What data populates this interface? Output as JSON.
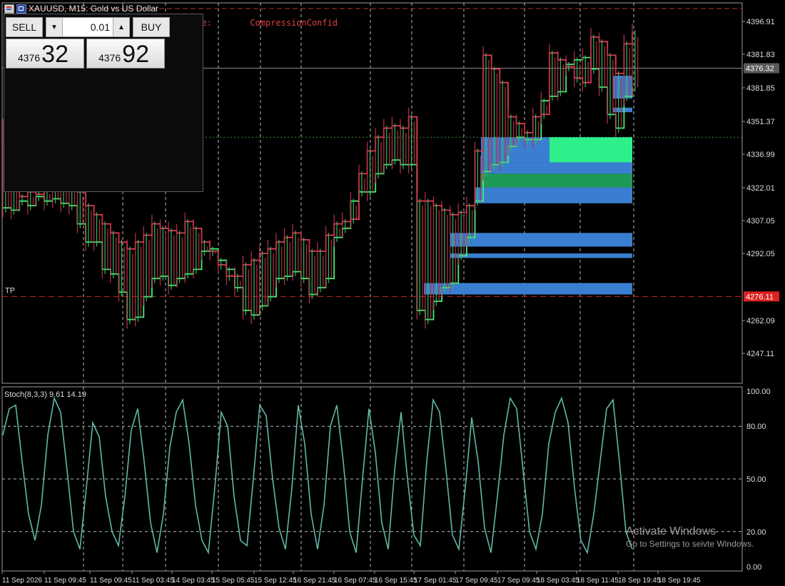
{
  "window": {
    "title": "XAUUSD, M15:  Gold vs US Dollar"
  },
  "indicator_labels": [
    "ceRegime:",
    "CompressionConfid"
  ],
  "trade_panel": {
    "sell_label": "SELL",
    "buy_label": "BUY",
    "lot_value": "0.01",
    "sell_price_small": "4376",
    "sell_price_big": "32",
    "buy_price_small": "4376",
    "buy_price_big": "92"
  },
  "current_price_label": "4376.32",
  "tp_price_label": "4276.11",
  "tp_text": "TP",
  "oscillator_label": "Stoch(8,3,3) 9.61 14.19",
  "watermark": {
    "line1": "Activate Windows",
    "line2": "Go to Settings to seivte Windows."
  },
  "colors": {
    "fast_line": "#44ee77",
    "slow_line": "#e03a55",
    "zone_blue": "#3a7ed1",
    "zone_green": "#2ef08a",
    "zone_dark_green": "#1e9a58",
    "stoch_line": "#5fb8a8",
    "tp_line": "#cc2222",
    "grid": "#bbbbbb"
  },
  "chart_data": [
    {
      "type": "line",
      "name": "price",
      "symbol": "XAUUSD",
      "timeframe": "M15",
      "y_tick_labels": [
        "4396.91",
        "4381.83",
        "4381.85",
        "4351.37",
        "4336.99",
        "4322.01",
        "4307.05",
        "4292.05",
        "4262.09",
        "4247.11"
      ],
      "x_tick_labels": [
        "11 Sep 2026",
        "11 Sep 09:45",
        "11 Sep 09:45",
        "11 Sep 03:45",
        "14 Sep 03:45",
        "15 Sep 05:45",
        "15 Sep 12:45",
        "16 Sep 21:45",
        "16 Sep 07:45",
        "16 Sep 15:45",
        "17 Sep 01:45",
        "17 Sep 09:45",
        "17 Sep 09:45",
        "18 Sep 03:45",
        "18 Sep 11:45",
        "18 Sep 19:45",
        "18 Sep 19:45"
      ],
      "ylim": [
        4238,
        4405
      ],
      "current_price": 4376.32,
      "take_profit": 4276.11,
      "dotted_level": 4346,
      "series": [
        {
          "name": "fast",
          "values": [
            4315,
            4314,
            4318,
            4316,
            4320,
            4318,
            4319,
            4317,
            4316,
            4308,
            4300,
            4300,
            4288,
            4286,
            4278,
            4266,
            4267,
            4276,
            4284,
            4285,
            4281,
            4284,
            4286,
            4288,
            4296,
            4297,
            4292,
            4288,
            4280,
            4270,
            4268,
            4272,
            4276,
            4284,
            4285,
            4287,
            4284,
            4277,
            4280,
            4284,
            4302,
            4306,
            4318,
            4322,
            4322,
            4330,
            4334,
            4336,
            4334,
            4334,
            4270,
            4266,
            4274,
            4280,
            4282,
            4294,
            4302,
            4318,
            4331,
            4334,
            4335,
            4342,
            4346,
            4345,
            4345,
            4362,
            4364,
            4366,
            4378,
            4380,
            4381,
            4376,
            4368,
            4356,
            4350,
            4364,
            4368
          ]
        },
        {
          "name": "slow",
          "values": [
            4350,
            4337,
            4320,
            4322,
            4321,
            4323,
            4326,
            4325,
            4324,
            4322,
            4316,
            4312,
            4308,
            4304,
            4300,
            4297,
            4300,
            4303,
            4308,
            4306,
            4305,
            4304,
            4309,
            4306,
            4300,
            4296,
            4290,
            4285,
            4285,
            4290,
            4292,
            4295,
            4297,
            4300,
            4302,
            4304,
            4301,
            4296,
            4296,
            4303,
            4308,
            4309,
            4310,
            4330,
            4340,
            4346,
            4350,
            4351,
            4350,
            4355,
            4318,
            4318,
            4316,
            4314,
            4312,
            4313,
            4316,
            4340,
            4382,
            4376,
            4370,
            4355,
            4352,
            4348,
            4355,
            4356,
            4383,
            4380,
            4377,
            4372,
            4370,
            4390,
            4388,
            4382,
            4374,
            4387,
            4392
          ]
        }
      ],
      "zones": [
        {
          "kind": "blue",
          "top": 4346,
          "bottom": 4335
        },
        {
          "kind": "green",
          "top": 4346,
          "bottom": 4335
        },
        {
          "kind": "blue",
          "top": 4335,
          "bottom": 4330
        },
        {
          "kind": "dark_green",
          "top": 4330,
          "bottom": 4324
        },
        {
          "kind": "blue",
          "top": 4324,
          "bottom": 4317
        },
        {
          "kind": "blue",
          "top": 4304,
          "bottom": 4298
        },
        {
          "kind": "blue",
          "top": 4295,
          "bottom": 4293
        },
        {
          "kind": "blue",
          "top": 4282,
          "bottom": 4277
        },
        {
          "kind": "blue",
          "top": 4373,
          "bottom": 4363
        },
        {
          "kind": "blue",
          "top": 4359,
          "bottom": 4357
        }
      ]
    },
    {
      "type": "line",
      "name": "Stoch(8,3,3)",
      "ylim": [
        0,
        100
      ],
      "y_tick_labels": [
        "100.00",
        "80.00",
        "50.00",
        "20.00",
        "0.00"
      ],
      "levels": [
        80,
        50,
        20
      ],
      "values": [
        75,
        90,
        92,
        60,
        30,
        15,
        35,
        75,
        96,
        88,
        55,
        20,
        10,
        45,
        82,
        74,
        40,
        20,
        12,
        40,
        78,
        90,
        60,
        25,
        8,
        30,
        68,
        88,
        95,
        70,
        35,
        15,
        8,
        45,
        88,
        80,
        40,
        15,
        12,
        50,
        92,
        86,
        50,
        22,
        10,
        45,
        92,
        70,
        30,
        10,
        35,
        80,
        92,
        60,
        20,
        8,
        50,
        90,
        65,
        25,
        10,
        55,
        88,
        50,
        18,
        12,
        60,
        95,
        88,
        55,
        18,
        10,
        45,
        85,
        60,
        22,
        8,
        40,
        75,
        96,
        90,
        55,
        20,
        10,
        30,
        70,
        88,
        96,
        82,
        45,
        15,
        8,
        30,
        60,
        90,
        95,
        60,
        20,
        10
      ]
    }
  ]
}
